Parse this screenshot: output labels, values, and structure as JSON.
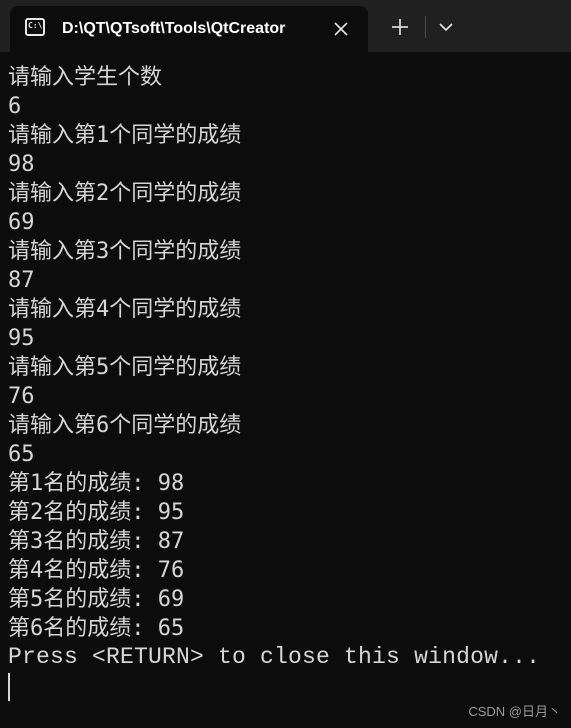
{
  "tab": {
    "title": "D:\\QT\\QTsoft\\Tools\\QtCreator",
    "icon": "terminal-icon"
  },
  "controls": {
    "close_icon": "close-icon",
    "new_tab_icon": "plus-icon",
    "dropdown_icon": "chevron-down-icon"
  },
  "terminal": {
    "lines": [
      "请输入学生个数",
      "6",
      "请输入第1个同学的成绩",
      "98",
      "请输入第2个同学的成绩",
      "69",
      "请输入第3个同学的成绩",
      "87",
      "请输入第4个同学的成绩",
      "95",
      "请输入第5个同学的成绩",
      "76",
      "请输入第6个同学的成绩",
      "65",
      "第1名的成绩: 98",
      "第2名的成绩: 95",
      "第3名的成绩: 87",
      "第4名的成绩: 76",
      "第5名的成绩: 69",
      "第6名的成绩: 65",
      "Press <RETURN> to close this window..."
    ]
  },
  "watermark": "CSDN @日月丶",
  "colors": {
    "background": "#0c0c0c",
    "tabbar": "#202020",
    "text": "#d6d6d6"
  }
}
